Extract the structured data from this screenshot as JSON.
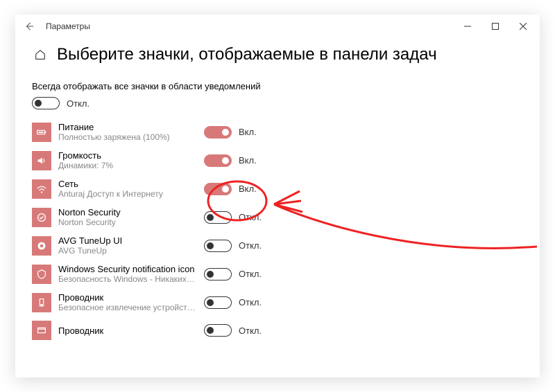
{
  "window": {
    "title": "Параметры"
  },
  "page": {
    "heading": "Выберите значки, отображаемые в панели задач",
    "always_show_label": "Всегда отображать все значки в области уведомлений",
    "master_toggle": {
      "on": false,
      "label": "Откл."
    }
  },
  "labels": {
    "on": "Вкл.",
    "off": "Откл."
  },
  "items": [
    {
      "icon": "battery",
      "title": "Питание",
      "sub": "Полностью заряжена (100%)",
      "on": true
    },
    {
      "icon": "volume",
      "title": "Громкость",
      "sub": "Динамики: 7%",
      "on": true
    },
    {
      "icon": "wifi",
      "title": "Сеть",
      "sub": "Anturaj Доступ к Интернету",
      "on": true
    },
    {
      "icon": "norton",
      "title": "Norton Security",
      "sub": "Norton Security",
      "on": false
    },
    {
      "icon": "avg",
      "title": "AVG TuneUp UI",
      "sub": "AVG TuneUp",
      "on": false
    },
    {
      "icon": "security",
      "title": "Windows Security notification icon",
      "sub": "Безопасность Windows - Никаких…",
      "on": false
    },
    {
      "icon": "explorer",
      "title": "Проводник",
      "sub": "Безопасное извлечение устройств…",
      "on": false
    },
    {
      "icon": "explorer2",
      "title": "Проводник",
      "sub": "",
      "on": false
    }
  ]
}
